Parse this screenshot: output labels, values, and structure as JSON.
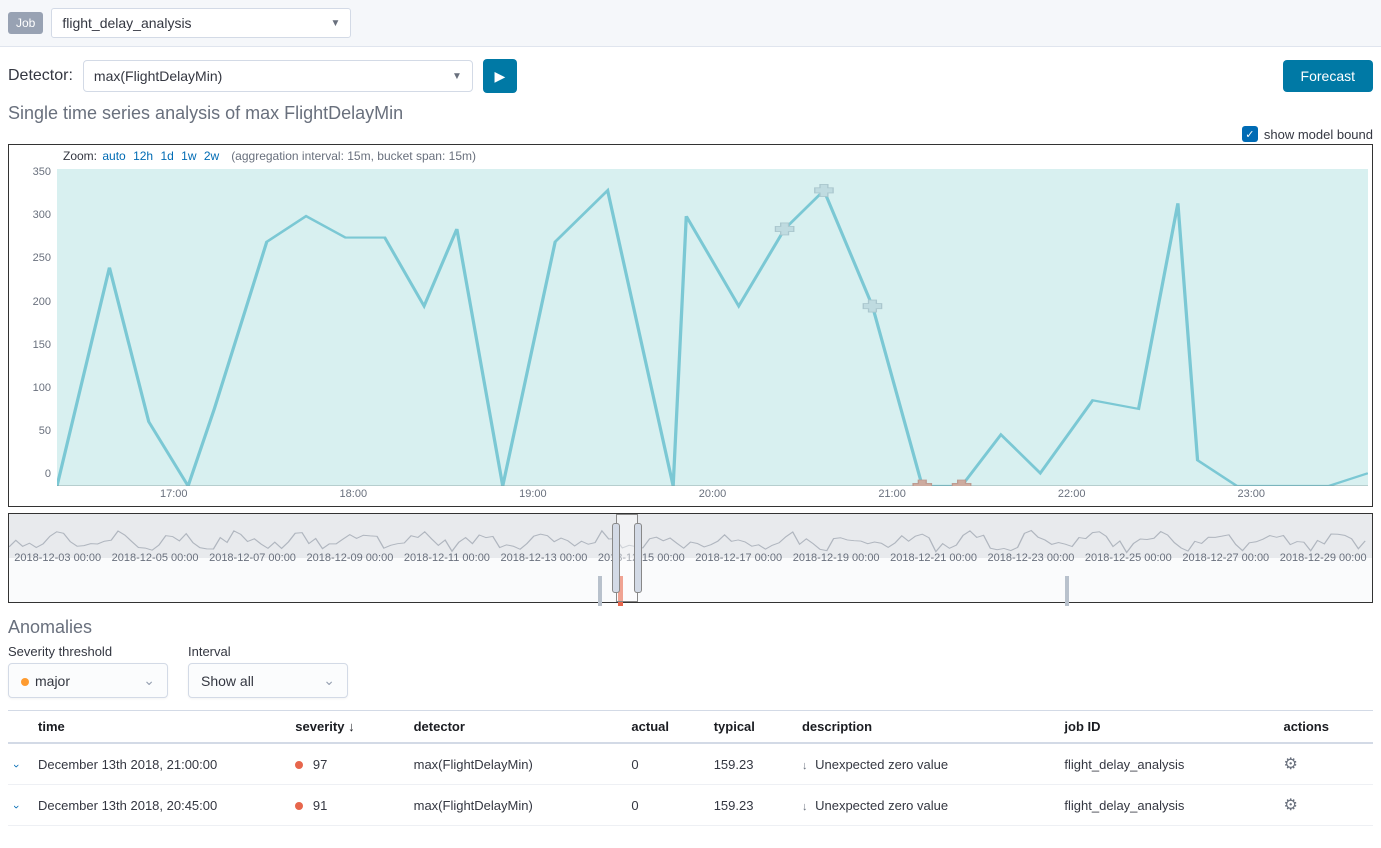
{
  "job": {
    "badge": "Job",
    "name": "flight_delay_analysis"
  },
  "detector": {
    "label": "Detector:",
    "value": "max(FlightDelayMin)"
  },
  "forecast_btn": "Forecast",
  "section_title": "Single time series analysis of max FlightDelayMin",
  "show_model_bound": "show model bound",
  "zoom": {
    "label": "Zoom:",
    "options": [
      "auto",
      "12h",
      "1d",
      "1w",
      "2w"
    ],
    "agg_text": "(aggregation interval: 15m, bucket span: 15m)"
  },
  "overview_dates": [
    "2018-12-03 00:00",
    "2018-12-05 00:00",
    "2018-12-07 00:00",
    "2018-12-09 00:00",
    "2018-12-11 00:00",
    "2018-12-13 00:00",
    "2018-12-15 00:00",
    "2018-12-17 00:00",
    "2018-12-19 00:00",
    "2018-12-21 00:00",
    "2018-12-23 00:00",
    "2018-12-25 00:00",
    "2018-12-27 00:00",
    "2018-12-29 00:00"
  ],
  "anomalies": {
    "heading": "Anomalies",
    "severity_threshold_label": "Severity threshold",
    "severity_value": "major",
    "interval_label": "Interval",
    "interval_value": "Show all",
    "table": {
      "headers": {
        "time": "time",
        "severity": "severity",
        "detector": "detector",
        "actual": "actual",
        "typical": "typical",
        "description": "description",
        "job_id": "job ID",
        "actions": "actions"
      },
      "rows": [
        {
          "time": "December 13th 2018, 21:00:00",
          "severity": "97",
          "detector": "max(FlightDelayMin)",
          "actual": "0",
          "typical": "159.23",
          "description": "Unexpected zero value",
          "job_id": "flight_delay_analysis"
        },
        {
          "time": "December 13th 2018, 20:45:00",
          "severity": "91",
          "detector": "max(FlightDelayMin)",
          "actual": "0",
          "typical": "159.23",
          "description": "Unexpected zero value",
          "job_id": "flight_delay_analysis"
        }
      ]
    }
  },
  "chart_data": {
    "type": "line",
    "ylabel": "",
    "ylim": [
      0,
      370
    ],
    "y_ticks": [
      0,
      50,
      100,
      150,
      200,
      250,
      300,
      350
    ],
    "x_ticks": [
      "17:00",
      "18:00",
      "19:00",
      "20:00",
      "21:00",
      "22:00",
      "23:00"
    ],
    "series": [
      {
        "name": "max(FlightDelayMin)",
        "points": [
          {
            "x": 0.0,
            "y": 0
          },
          {
            "x": 0.04,
            "y": 255
          },
          {
            "x": 0.07,
            "y": 75
          },
          {
            "x": 0.1,
            "y": 0
          },
          {
            "x": 0.12,
            "y": 90
          },
          {
            "x": 0.16,
            "y": 285
          },
          {
            "x": 0.19,
            "y": 315
          },
          {
            "x": 0.22,
            "y": 290
          },
          {
            "x": 0.25,
            "y": 290
          },
          {
            "x": 0.28,
            "y": 210
          },
          {
            "x": 0.305,
            "y": 300
          },
          {
            "x": 0.34,
            "y": 0
          },
          {
            "x": 0.38,
            "y": 285
          },
          {
            "x": 0.42,
            "y": 345
          },
          {
            "x": 0.47,
            "y": 0
          },
          {
            "x": 0.48,
            "y": 315
          },
          {
            "x": 0.52,
            "y": 210
          },
          {
            "x": 0.555,
            "y": 300
          },
          {
            "x": 0.585,
            "y": 345
          },
          {
            "x": 0.622,
            "y": 210
          },
          {
            "x": 0.66,
            "y": 0
          },
          {
            "x": 0.69,
            "y": 0
          },
          {
            "x": 0.72,
            "y": 60
          },
          {
            "x": 0.75,
            "y": 15
          },
          {
            "x": 0.79,
            "y": 100
          },
          {
            "x": 0.825,
            "y": 90
          },
          {
            "x": 0.855,
            "y": 330
          },
          {
            "x": 0.87,
            "y": 30
          },
          {
            "x": 0.9,
            "y": 0
          },
          {
            "x": 0.935,
            "y": 0
          },
          {
            "x": 0.97,
            "y": 0
          },
          {
            "x": 1.0,
            "y": 15
          }
        ]
      }
    ],
    "anomaly_markers": [
      {
        "x": 0.555,
        "y": 300,
        "severity": "low"
      },
      {
        "x": 0.585,
        "y": 345,
        "severity": "low"
      },
      {
        "x": 0.622,
        "y": 210,
        "severity": "low"
      },
      {
        "x": 0.66,
        "y": 0,
        "severity": "critical"
      },
      {
        "x": 0.69,
        "y": 0,
        "severity": "critical"
      }
    ]
  }
}
